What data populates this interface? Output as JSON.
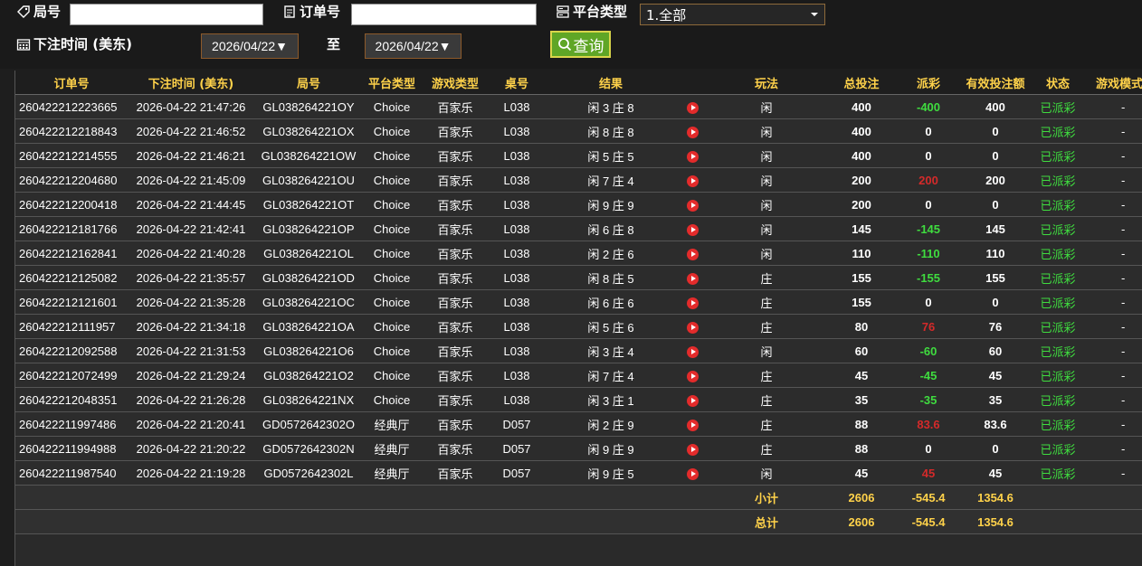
{
  "filters": {
    "round_label": "局号",
    "round_value": "",
    "order_label": "订单号",
    "order_value": "",
    "platform_label": "平台类型",
    "platform_value": "1.全部",
    "time_label": "下注时间 (美东)",
    "date_from": "2026/04/22▼",
    "to_label": "至",
    "date_to": "2026/04/22▼",
    "search_label": "查询"
  },
  "table": {
    "headers": [
      "订单号",
      "下注时间 (美东)",
      "局号",
      "平台类型",
      "游戏类型",
      "桌号",
      "结果",
      "",
      "玩法",
      "总投注",
      "派彩",
      "有效投注额",
      "状态",
      "游戏模式"
    ],
    "rows": [
      {
        "order": "260422212223665",
        "time": "2026-04-22 21:47:26",
        "round": "GL038264221OY",
        "platform": "Choice",
        "game": "百家乐",
        "table": "L038",
        "result": "闲 3 庄 8",
        "bet": "闲",
        "total": "400",
        "payout": "-400",
        "payout_type": "neg",
        "valid": "400",
        "status": "已派彩",
        "mode": "-"
      },
      {
        "order": "260422212218843",
        "time": "2026-04-22 21:46:52",
        "round": "GL038264221OX",
        "platform": "Choice",
        "game": "百家乐",
        "table": "L038",
        "result": "闲 8 庄 8",
        "bet": "闲",
        "total": "400",
        "payout": "0",
        "payout_type": "zero",
        "valid": "0",
        "status": "已派彩",
        "mode": "-"
      },
      {
        "order": "260422212214555",
        "time": "2026-04-22 21:46:21",
        "round": "GL038264221OW",
        "platform": "Choice",
        "game": "百家乐",
        "table": "L038",
        "result": "闲 5 庄 5",
        "bet": "闲",
        "total": "400",
        "payout": "0",
        "payout_type": "zero",
        "valid": "0",
        "status": "已派彩",
        "mode": "-"
      },
      {
        "order": "260422212204680",
        "time": "2026-04-22 21:45:09",
        "round": "GL038264221OU",
        "platform": "Choice",
        "game": "百家乐",
        "table": "L038",
        "result": "闲 7 庄 4",
        "bet": "闲",
        "total": "200",
        "payout": "200",
        "payout_type": "pos",
        "valid": "200",
        "status": "已派彩",
        "mode": "-"
      },
      {
        "order": "260422212200418",
        "time": "2026-04-22 21:44:45",
        "round": "GL038264221OT",
        "platform": "Choice",
        "game": "百家乐",
        "table": "L038",
        "result": "闲 9 庄 9",
        "bet": "闲",
        "total": "200",
        "payout": "0",
        "payout_type": "zero",
        "valid": "0",
        "status": "已派彩",
        "mode": "-"
      },
      {
        "order": "260422212181766",
        "time": "2026-04-22 21:42:41",
        "round": "GL038264221OP",
        "platform": "Choice",
        "game": "百家乐",
        "table": "L038",
        "result": "闲 6 庄 8",
        "bet": "闲",
        "total": "145",
        "payout": "-145",
        "payout_type": "neg",
        "valid": "145",
        "status": "已派彩",
        "mode": "-"
      },
      {
        "order": "260422212162841",
        "time": "2026-04-22 21:40:28",
        "round": "GL038264221OL",
        "platform": "Choice",
        "game": "百家乐",
        "table": "L038",
        "result": "闲 2 庄 6",
        "bet": "闲",
        "total": "110",
        "payout": "-110",
        "payout_type": "neg",
        "valid": "110",
        "status": "已派彩",
        "mode": "-"
      },
      {
        "order": "260422212125082",
        "time": "2026-04-22 21:35:57",
        "round": "GL038264221OD",
        "platform": "Choice",
        "game": "百家乐",
        "table": "L038",
        "result": "闲 8 庄 5",
        "bet": "庄",
        "total": "155",
        "payout": "-155",
        "payout_type": "neg",
        "valid": "155",
        "status": "已派彩",
        "mode": "-"
      },
      {
        "order": "260422212121601",
        "time": "2026-04-22 21:35:28",
        "round": "GL038264221OC",
        "platform": "Choice",
        "game": "百家乐",
        "table": "L038",
        "result": "闲 6 庄 6",
        "bet": "庄",
        "total": "155",
        "payout": "0",
        "payout_type": "zero",
        "valid": "0",
        "status": "已派彩",
        "mode": "-"
      },
      {
        "order": "260422212111957",
        "time": "2026-04-22 21:34:18",
        "round": "GL038264221OA",
        "platform": "Choice",
        "game": "百家乐",
        "table": "L038",
        "result": "闲 5 庄 6",
        "bet": "庄",
        "total": "80",
        "payout": "76",
        "payout_type": "pos",
        "valid": "76",
        "status": "已派彩",
        "mode": "-"
      },
      {
        "order": "260422212092588",
        "time": "2026-04-22 21:31:53",
        "round": "GL038264221O6",
        "platform": "Choice",
        "game": "百家乐",
        "table": "L038",
        "result": "闲 3 庄 4",
        "bet": "闲",
        "total": "60",
        "payout": "-60",
        "payout_type": "neg",
        "valid": "60",
        "status": "已派彩",
        "mode": "-"
      },
      {
        "order": "260422212072499",
        "time": "2026-04-22 21:29:24",
        "round": "GL038264221O2",
        "platform": "Choice",
        "game": "百家乐",
        "table": "L038",
        "result": "闲 7 庄 4",
        "bet": "庄",
        "total": "45",
        "payout": "-45",
        "payout_type": "neg",
        "valid": "45",
        "status": "已派彩",
        "mode": "-"
      },
      {
        "order": "260422212048351",
        "time": "2026-04-22 21:26:28",
        "round": "GL038264221NX",
        "platform": "Choice",
        "game": "百家乐",
        "table": "L038",
        "result": "闲 3 庄 1",
        "bet": "庄",
        "total": "35",
        "payout": "-35",
        "payout_type": "neg",
        "valid": "35",
        "status": "已派彩",
        "mode": "-"
      },
      {
        "order": "260422211997486",
        "time": "2026-04-22 21:20:41",
        "round": "GD0572642302O",
        "platform": "经典厅",
        "game": "百家乐",
        "table": "D057",
        "result": "闲 2 庄 9",
        "bet": "庄",
        "total": "88",
        "payout": "83.6",
        "payout_type": "pos",
        "valid": "83.6",
        "status": "已派彩",
        "mode": "-"
      },
      {
        "order": "260422211994988",
        "time": "2026-04-22 21:20:22",
        "round": "GD0572642302N",
        "platform": "经典厅",
        "game": "百家乐",
        "table": "D057",
        "result": "闲 9 庄 9",
        "bet": "庄",
        "total": "88",
        "payout": "0",
        "payout_type": "zero",
        "valid": "0",
        "status": "已派彩",
        "mode": "-"
      },
      {
        "order": "260422211987540",
        "time": "2026-04-22 21:19:28",
        "round": "GD0572642302L",
        "platform": "经典厅",
        "game": "百家乐",
        "table": "D057",
        "result": "闲 9 庄 5",
        "bet": "闲",
        "total": "45",
        "payout": "45",
        "payout_type": "pos",
        "valid": "45",
        "status": "已派彩",
        "mode": "-"
      }
    ],
    "subtotal": {
      "label": "小计",
      "total": "2606",
      "payout": "-545.4",
      "valid": "1354.6"
    },
    "grandtotal": {
      "label": "总计",
      "total": "2606",
      "payout": "-545.4",
      "valid": "1354.6"
    }
  },
  "colors": {
    "header_text": "#ffd24a",
    "negative": "#3fdc3f",
    "positive": "#d42a2a",
    "status": "#3fdc3f",
    "search_button": "#5fa626"
  }
}
